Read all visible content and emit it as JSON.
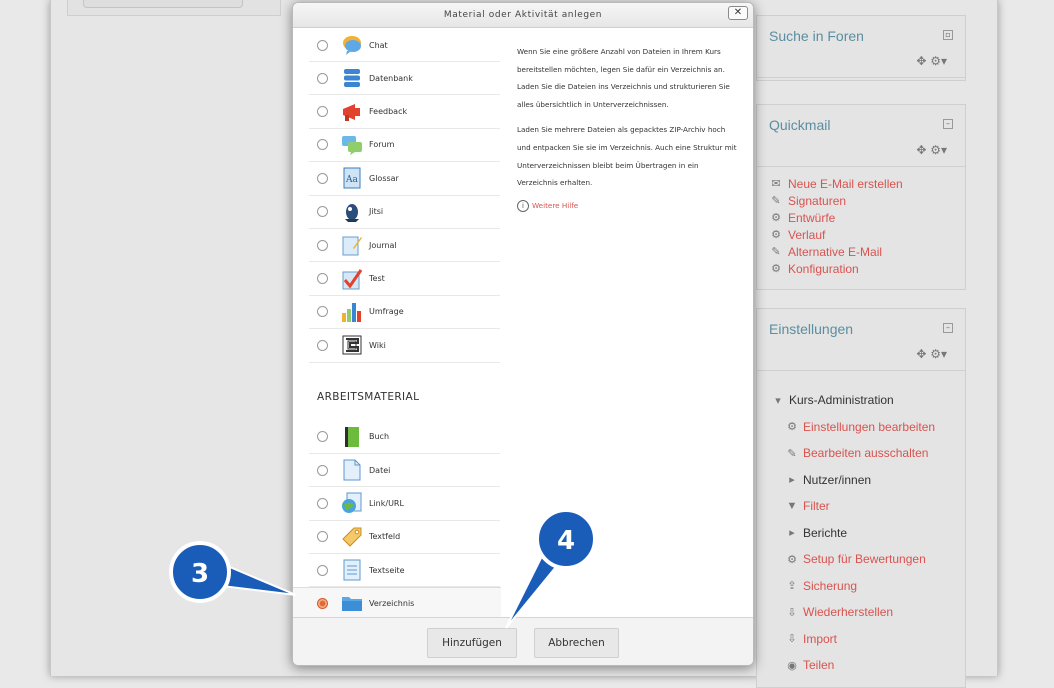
{
  "modal": {
    "title": "Material oder Aktivität anlegen",
    "close_label": "✕",
    "activities": [
      {
        "label": "Chat",
        "icon": "chat-icon"
      },
      {
        "label": "Datenbank",
        "icon": "database-icon"
      },
      {
        "label": "Feedback",
        "icon": "feedback-icon"
      },
      {
        "label": "Forum",
        "icon": "forum-icon"
      },
      {
        "label": "Glossar",
        "icon": "glossary-icon"
      },
      {
        "label": "Jitsi",
        "icon": "jitsi-icon"
      },
      {
        "label": "Journal",
        "icon": "journal-icon"
      },
      {
        "label": "Test",
        "icon": "quiz-icon"
      },
      {
        "label": "Umfrage",
        "icon": "survey-icon"
      },
      {
        "label": "Wiki",
        "icon": "wiki-icon"
      }
    ],
    "resource_section_title": "ARBEITSMATERIAL",
    "resources": [
      {
        "label": "Buch",
        "icon": "book-icon"
      },
      {
        "label": "Datei",
        "icon": "file-icon"
      },
      {
        "label": "Link/URL",
        "icon": "url-icon"
      },
      {
        "label": "Textfeld",
        "icon": "label-icon"
      },
      {
        "label": "Textseite",
        "icon": "page-icon"
      },
      {
        "label": "Verzeichnis",
        "icon": "folder-icon",
        "selected": true
      }
    ],
    "help": {
      "paragraph1": "Wenn Sie eine größere Anzahl von Dateien in Ihrem Kurs bereitstellen möchten, legen Sie dafür ein Verzeichnis an. Laden Sie die Dateien ins Verzeichnis und strukturieren Sie alles übersichtlich in Unterverzeichnissen.",
      "paragraph2": "Laden Sie mehrere Dateien als gepacktes ZIP-Archiv hoch und entpacken Sie sie im Verzeichnis. Auch eine Struktur mit Unterverzeichnissen bleibt beim Übertragen in ein Verzeichnis erhalten.",
      "more_help": "Weitere Hilfe"
    },
    "add_button": "Hinzufügen",
    "cancel_button": "Abbrechen"
  },
  "right_column": {
    "search_forums": {
      "title": "Suche in Foren"
    },
    "quickmail": {
      "title": "Quickmail",
      "items": [
        {
          "label": "Neue E-Mail erstellen",
          "icon": "mail-icon"
        },
        {
          "label": "Signaturen",
          "icon": "pencil-icon"
        },
        {
          "label": "Entwürfe",
          "icon": "gear-icon"
        },
        {
          "label": "Verlauf",
          "icon": "gear-icon"
        },
        {
          "label": "Alternative E-Mail",
          "icon": "pencil-icon"
        },
        {
          "label": "Konfiguration",
          "icon": "gear-icon"
        }
      ]
    },
    "settings": {
      "title": "Einstellungen",
      "items": [
        {
          "label": "Kurs-Administration",
          "icon": "caret-down-icon"
        },
        {
          "label": "Einstellungen bearbeiten",
          "icon": "gear-icon"
        },
        {
          "label": "Bearbeiten ausschalten",
          "icon": "pencil-icon"
        },
        {
          "label": "Nutzer/innen",
          "icon": "caret-right-icon"
        },
        {
          "label": "Filter",
          "icon": "filter-icon"
        },
        {
          "label": "Berichte",
          "icon": "caret-right-icon"
        },
        {
          "label": "Setup für Bewertungen",
          "icon": "gear-icon"
        },
        {
          "label": "Sicherung",
          "icon": "upload-icon"
        },
        {
          "label": "Wiederherstellen",
          "icon": "download-icon"
        },
        {
          "label": "Import",
          "icon": "download-icon"
        },
        {
          "label": "Teilen",
          "icon": "share-icon"
        }
      ]
    }
  },
  "callouts": [
    {
      "number": "3",
      "color": "#1a5db8"
    },
    {
      "number": "4",
      "color": "#1a5db8"
    }
  ],
  "colors": {
    "link_red": "#d9534f",
    "block_title": "#5a8ea0",
    "callout_blue": "#1a5db8"
  }
}
